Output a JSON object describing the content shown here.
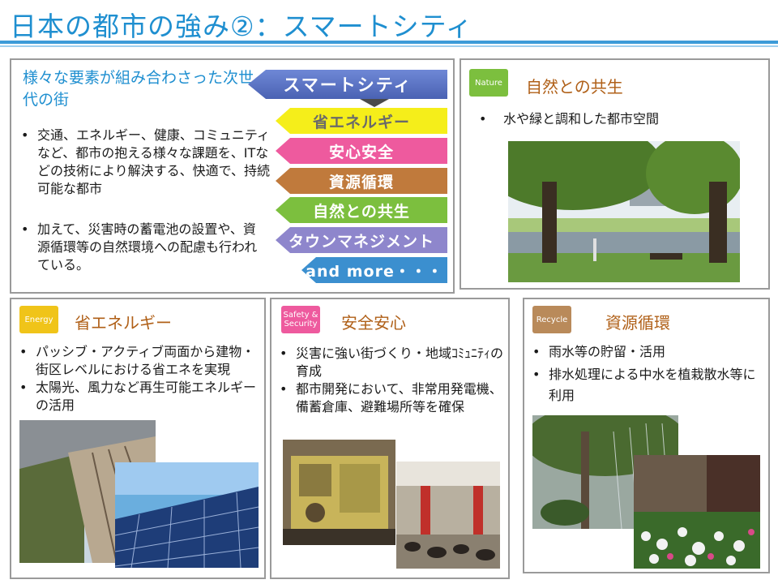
{
  "title": "日本の都市の強み②：スマートシティ",
  "smart": {
    "lead": "様々な要素が組み合わさった次世代の街",
    "bullets": [
      "交通、エネルギー、健康、コミュニティなど、都市の抱える様々な課題を、ITなどの技術により解決する、快適で、持続可能な都市",
      "加えて、災害時の蓄電池の設置や、資源循環等の自然環境への配慮も行われている。"
    ],
    "main_tag": "スマートシティ",
    "tags": [
      "省エネルギー",
      "安心安全",
      "資源循環",
      "自然との共生",
      "タウンマネジメント",
      "and more・・・"
    ]
  },
  "nature": {
    "badge": "Nature",
    "heading": "自然との共生",
    "bullets": [
      "水や緑と調和した都市空間"
    ]
  },
  "energy": {
    "badge": "Energy",
    "heading": "省エネルギー",
    "bullets": [
      "パッシブ・アクティブ両面から建物・街区レベルにおける省エネを実現",
      "太陽光、風力など再生可能エネルギーの活用"
    ]
  },
  "safety": {
    "badge_line1": "Safety &",
    "badge_line2": "Security",
    "heading": "安全安心",
    "bullets": [
      "災害に強い街づくり・地域ｺﾐｭﾆﾃｨの育成",
      "都市開発において、非常用発電機、備蓄倉庫、避難場所等を確保"
    ]
  },
  "recycle": {
    "badge": "Recycle",
    "heading": "資源循環",
    "bullets": [
      "雨水等の貯留・活用",
      "排水処理による中水を植栽散水等に利用"
    ]
  },
  "colors": {
    "title": "#1f8fd0",
    "main_tag": "#5a74c4",
    "energy_tag": "#f5ee1a",
    "safety_tag": "#ee5a9e",
    "recycle_tag": "#c07a3c",
    "nature_tag": "#7cbf3e",
    "town_tag": "#8e86cc",
    "more_tag": "#3b8fcf"
  }
}
